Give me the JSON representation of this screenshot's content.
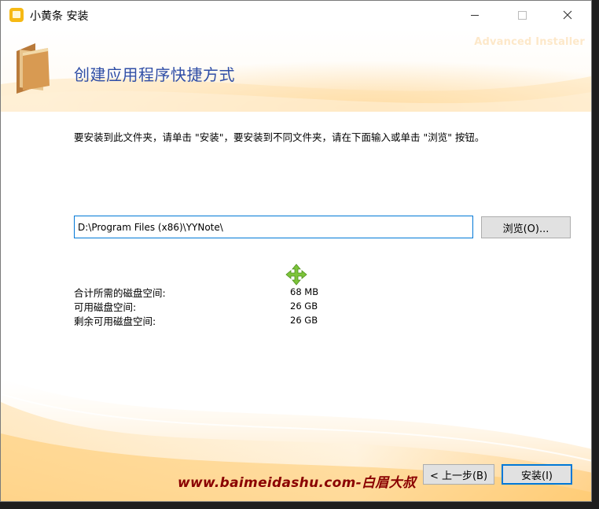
{
  "window": {
    "title": "小黄条 安装",
    "brand": "Advanced Installer"
  },
  "header": {
    "title": "创建应用程序快捷方式"
  },
  "instruction": "要安装到此文件夹，请单击 \"安装\"，要安装到不同文件夹，请在下面输入或单击 \"浏览\" 按钮。",
  "install_path": {
    "value": "D:\\Program Files (x86)\\YYNote\\"
  },
  "browse_button": {
    "label": "浏览(O)..."
  },
  "disk_space": [
    {
      "label": "合计所需的磁盘空间:",
      "value": "68 MB"
    },
    {
      "label": "可用磁盘空间:",
      "value": "26 GB"
    },
    {
      "label": "剩余可用磁盘空间:",
      "value": "26 GB"
    }
  ],
  "footer": {
    "watermark": "www.baimeidashu.com-白眉大叔",
    "back_label": "< 上一步(B)",
    "install_label": "安装(I)"
  },
  "colors": {
    "title_blue": "#2f4ea6",
    "accent": "#0078d7",
    "app_icon": "#f6b914",
    "watermark_red": "#8a0000"
  },
  "icons": {
    "app": "app-sticky-note-icon",
    "folder": "folder-icon",
    "move": "move-arrows-icon",
    "minimize": "minimize-icon",
    "maximize": "maximize-icon",
    "close": "close-icon"
  }
}
